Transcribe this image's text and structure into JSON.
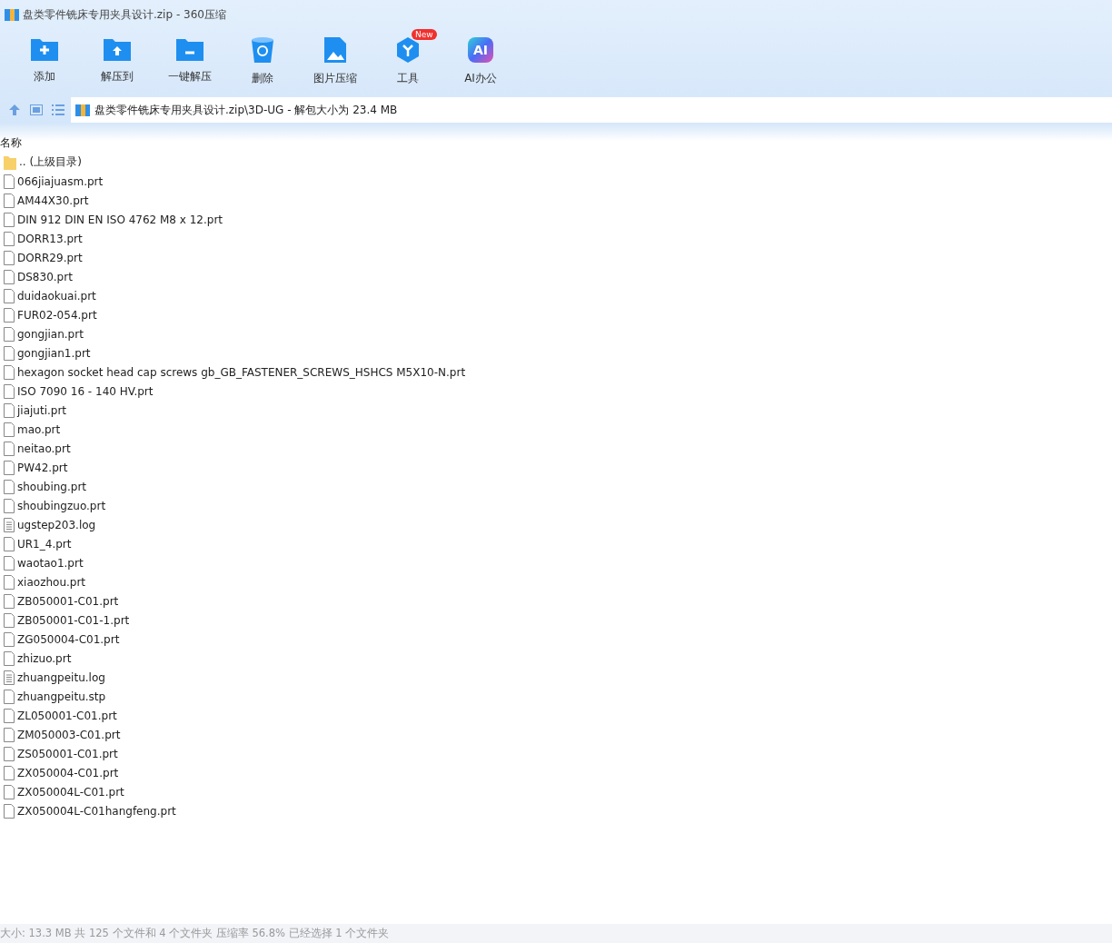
{
  "window": {
    "title": "盘类零件铣床专用夹具设计.zip - 360压缩"
  },
  "toolbar": [
    {
      "kind": "add",
      "label": "添加"
    },
    {
      "kind": "extract",
      "label": "解压到"
    },
    {
      "kind": "quick",
      "label": "一键解压"
    },
    {
      "kind": "delete",
      "label": "删除"
    },
    {
      "kind": "image",
      "label": "图片压缩"
    },
    {
      "kind": "tools",
      "label": "工具",
      "badge": "New"
    },
    {
      "kind": "ai",
      "label": "AI办公",
      "icon_text": "AI"
    }
  ],
  "address": {
    "path": "盘类零件铣床专用夹具设计.zip\\3D-UG - 解包大小为 23.4 MB"
  },
  "list": {
    "column": "名称",
    "rows": [
      {
        "kind": "folder",
        "name": ".. (上级目录)"
      },
      {
        "kind": "file",
        "name": "066jiajuasm.prt"
      },
      {
        "kind": "file",
        "name": "AM44X30.prt"
      },
      {
        "kind": "file",
        "name": "DIN 912 DIN EN ISO 4762 M8 x 12.prt"
      },
      {
        "kind": "file",
        "name": "DORR13.prt"
      },
      {
        "kind": "file",
        "name": "DORR29.prt"
      },
      {
        "kind": "file",
        "name": "DS830.prt"
      },
      {
        "kind": "file",
        "name": "duidaokuai.prt"
      },
      {
        "kind": "file",
        "name": "FUR02-054.prt"
      },
      {
        "kind": "file",
        "name": "gongjian.prt"
      },
      {
        "kind": "file",
        "name": "gongjian1.prt"
      },
      {
        "kind": "file",
        "name": "hexagon socket head cap screws gb_GB_FASTENER_SCREWS_HSHCS M5X10-N.prt"
      },
      {
        "kind": "file",
        "name": "ISO 7090 16 - 140 HV.prt"
      },
      {
        "kind": "file",
        "name": "jiajuti.prt"
      },
      {
        "kind": "file",
        "name": "mao.prt"
      },
      {
        "kind": "file",
        "name": "neitao.prt"
      },
      {
        "kind": "file",
        "name": "PW42.prt"
      },
      {
        "kind": "file",
        "name": "shoubing.prt"
      },
      {
        "kind": "file",
        "name": "shoubingzuo.prt"
      },
      {
        "kind": "log",
        "name": "ugstep203.log"
      },
      {
        "kind": "file",
        "name": "UR1_4.prt"
      },
      {
        "kind": "file",
        "name": "waotao1.prt"
      },
      {
        "kind": "file",
        "name": "xiaozhou.prt"
      },
      {
        "kind": "file",
        "name": "ZB050001-C01.prt"
      },
      {
        "kind": "file",
        "name": "ZB050001-C01-1.prt"
      },
      {
        "kind": "file",
        "name": "ZG050004-C01.prt"
      },
      {
        "kind": "file",
        "name": "zhizuo.prt"
      },
      {
        "kind": "log",
        "name": "zhuangpeitu.log"
      },
      {
        "kind": "file",
        "name": "zhuangpeitu.stp"
      },
      {
        "kind": "file",
        "name": "ZL050001-C01.prt"
      },
      {
        "kind": "file",
        "name": "ZM050003-C01.prt"
      },
      {
        "kind": "file",
        "name": "ZS050001-C01.prt"
      },
      {
        "kind": "file",
        "name": "ZX050004-C01.prt"
      },
      {
        "kind": "file",
        "name": "ZX050004L-C01.prt"
      },
      {
        "kind": "file",
        "name": "ZX050004L-C01hangfeng.prt"
      }
    ]
  },
  "status_bar": "大小: 13.3 MB 共 125 个文件和 4 个文件夹 压缩率 56.8% 已经选择 1 个文件夹"
}
